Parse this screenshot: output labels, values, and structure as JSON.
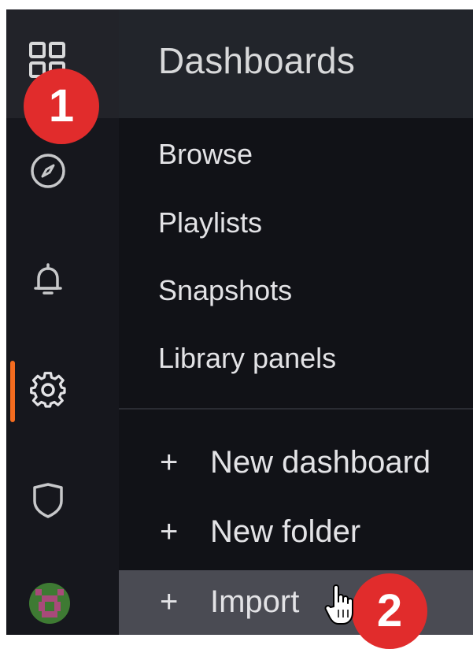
{
  "menu": {
    "title": "Dashboards",
    "items": [
      {
        "label": "Browse"
      },
      {
        "label": "Playlists"
      },
      {
        "label": "Snapshots"
      },
      {
        "label": "Library panels"
      }
    ],
    "actions": [
      {
        "icon": "+",
        "label": "New dashboard"
      },
      {
        "icon": "+",
        "label": "New folder"
      },
      {
        "icon": "+",
        "label": "Import",
        "highlighted": true
      }
    ]
  },
  "sidebar": {
    "icons": [
      "dashboards-grid-icon",
      "explore-compass-icon",
      "alerting-bell-icon",
      "configuration-gear-icon",
      "server-admin-shield-icon",
      "user-avatar"
    ],
    "active": "configuration-gear-icon"
  },
  "annotations": {
    "step1": "1",
    "step2": "2"
  },
  "colors": {
    "background": "#111217",
    "header": "#22252b",
    "accent": "#f46c1f",
    "highlight": "#4a4b53",
    "badge": "#e12c2c"
  }
}
